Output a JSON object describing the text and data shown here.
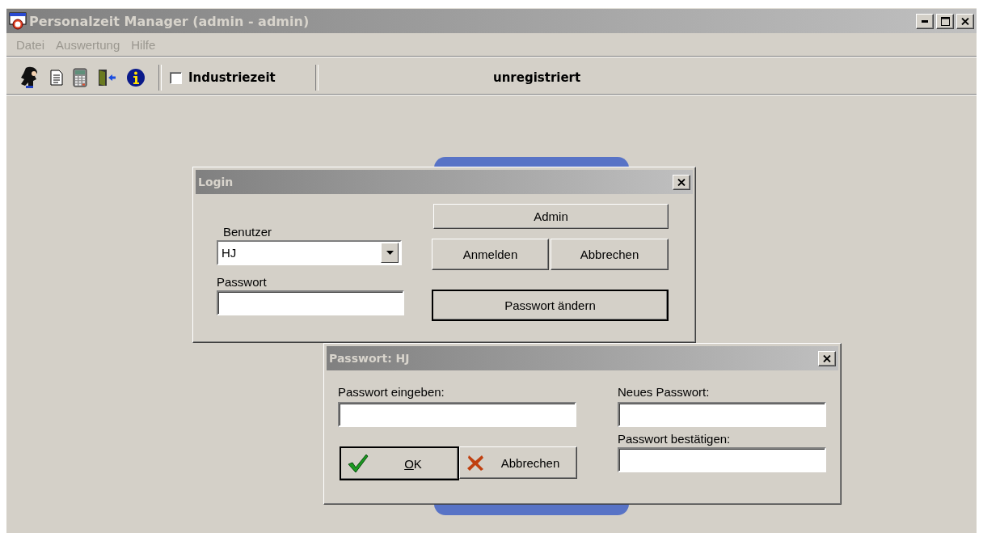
{
  "window": {
    "title": "Personalzeit Manager (admin - admin)",
    "active": false
  },
  "menu": [
    {
      "label": "Datei",
      "disabled": true
    },
    {
      "label": "Auswertung",
      "disabled": true
    },
    {
      "label": "Hilfe",
      "disabled": true
    }
  ],
  "toolbar": {
    "tools": [
      {
        "kind": "user"
      },
      {
        "kind": "document"
      },
      {
        "kind": "calculator"
      },
      {
        "kind": "exit"
      },
      {
        "kind": "info"
      }
    ],
    "checkbox": {
      "label": "Industriezeit",
      "checked": false
    },
    "status": "unregistriert"
  },
  "login_dialog": {
    "title": "Login",
    "active": false,
    "user_label": "Benutzer",
    "user_value": "HJ",
    "password_label": "Passwort",
    "buttons": [
      {
        "label": "Admin",
        "kind": "flat",
        "default": false
      },
      {
        "label": "Anmelden",
        "kind": "normal",
        "default": false
      },
      {
        "label": "Abbrechen",
        "kind": "normal",
        "default": false
      },
      {
        "label": "Passwort ändern",
        "kind": "wide",
        "default": true
      }
    ]
  },
  "password_dialog": {
    "title": "Passwort: HJ",
    "active": false,
    "fields": [
      {
        "label": "Passwort eingeben:"
      },
      {
        "label": "Neues Passwort:"
      },
      {
        "label": "Passwort bestätigen:"
      }
    ],
    "buttons": [
      {
        "label": "OK",
        "kind": "ok",
        "default": true,
        "mnemonic_underlined": true
      },
      {
        "label": "Abbrechen",
        "kind": "cancel",
        "default": false,
        "mnemonic_underlined": false
      }
    ]
  }
}
